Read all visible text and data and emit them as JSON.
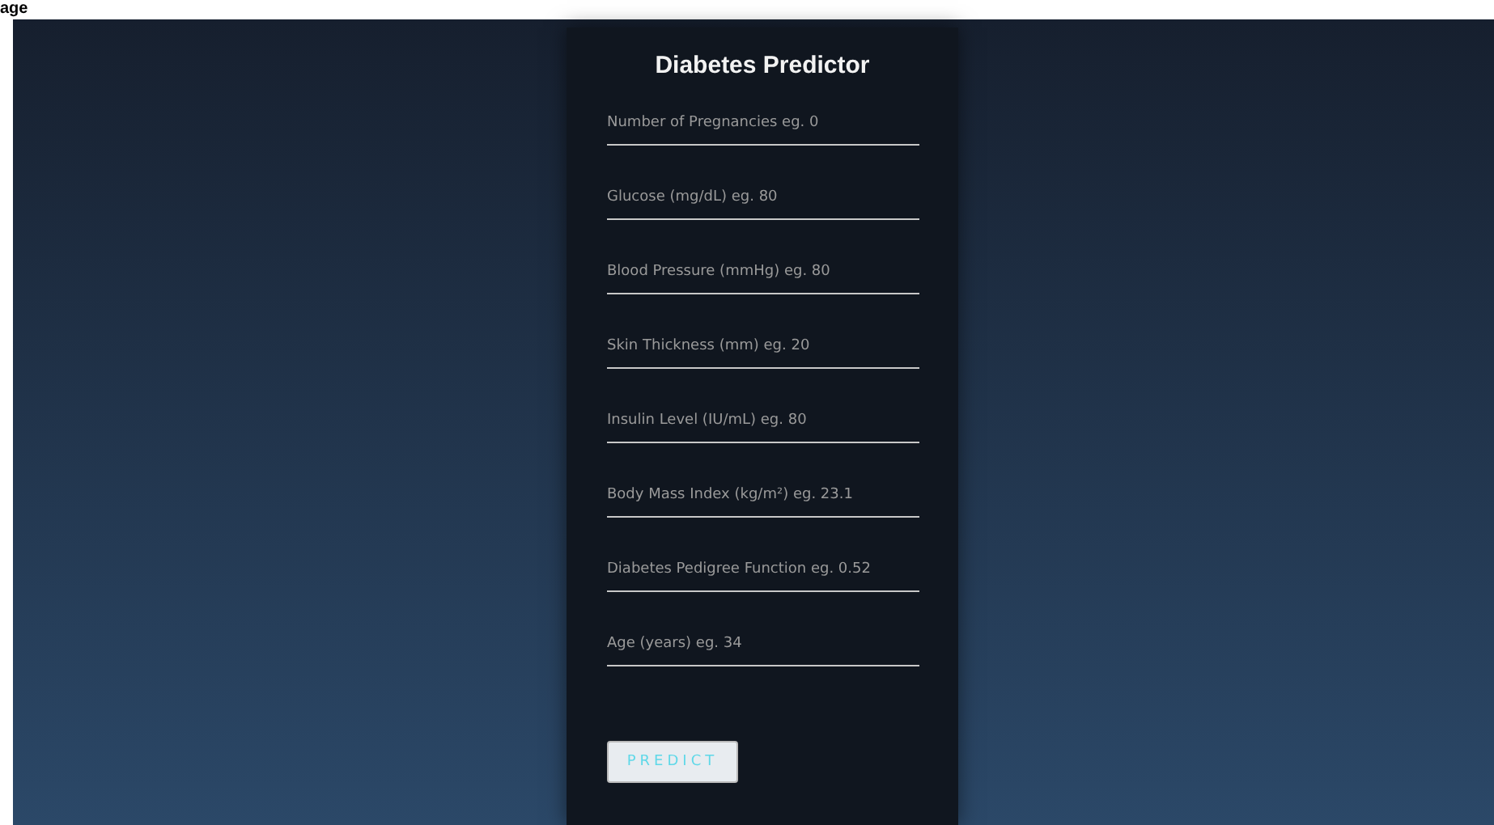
{
  "caption": "age",
  "form": {
    "title": "Diabetes Predictor",
    "fields": [
      {
        "placeholder": "Number of Pregnancies eg. 0"
      },
      {
        "placeholder": "Glucose (mg/dL) eg. 80"
      },
      {
        "placeholder": "Blood Pressure (mmHg) eg. 80"
      },
      {
        "placeholder": "Skin Thickness (mm) eg. 20"
      },
      {
        "placeholder": "Insulin Level (IU/mL) eg. 80"
      },
      {
        "placeholder": "Body Mass Index (kg/m²) eg. 23.1"
      },
      {
        "placeholder": "Diabetes Pedigree Function eg. 0.52"
      },
      {
        "placeholder": "Age (years) eg. 34"
      }
    ],
    "button": "PREDICT"
  }
}
